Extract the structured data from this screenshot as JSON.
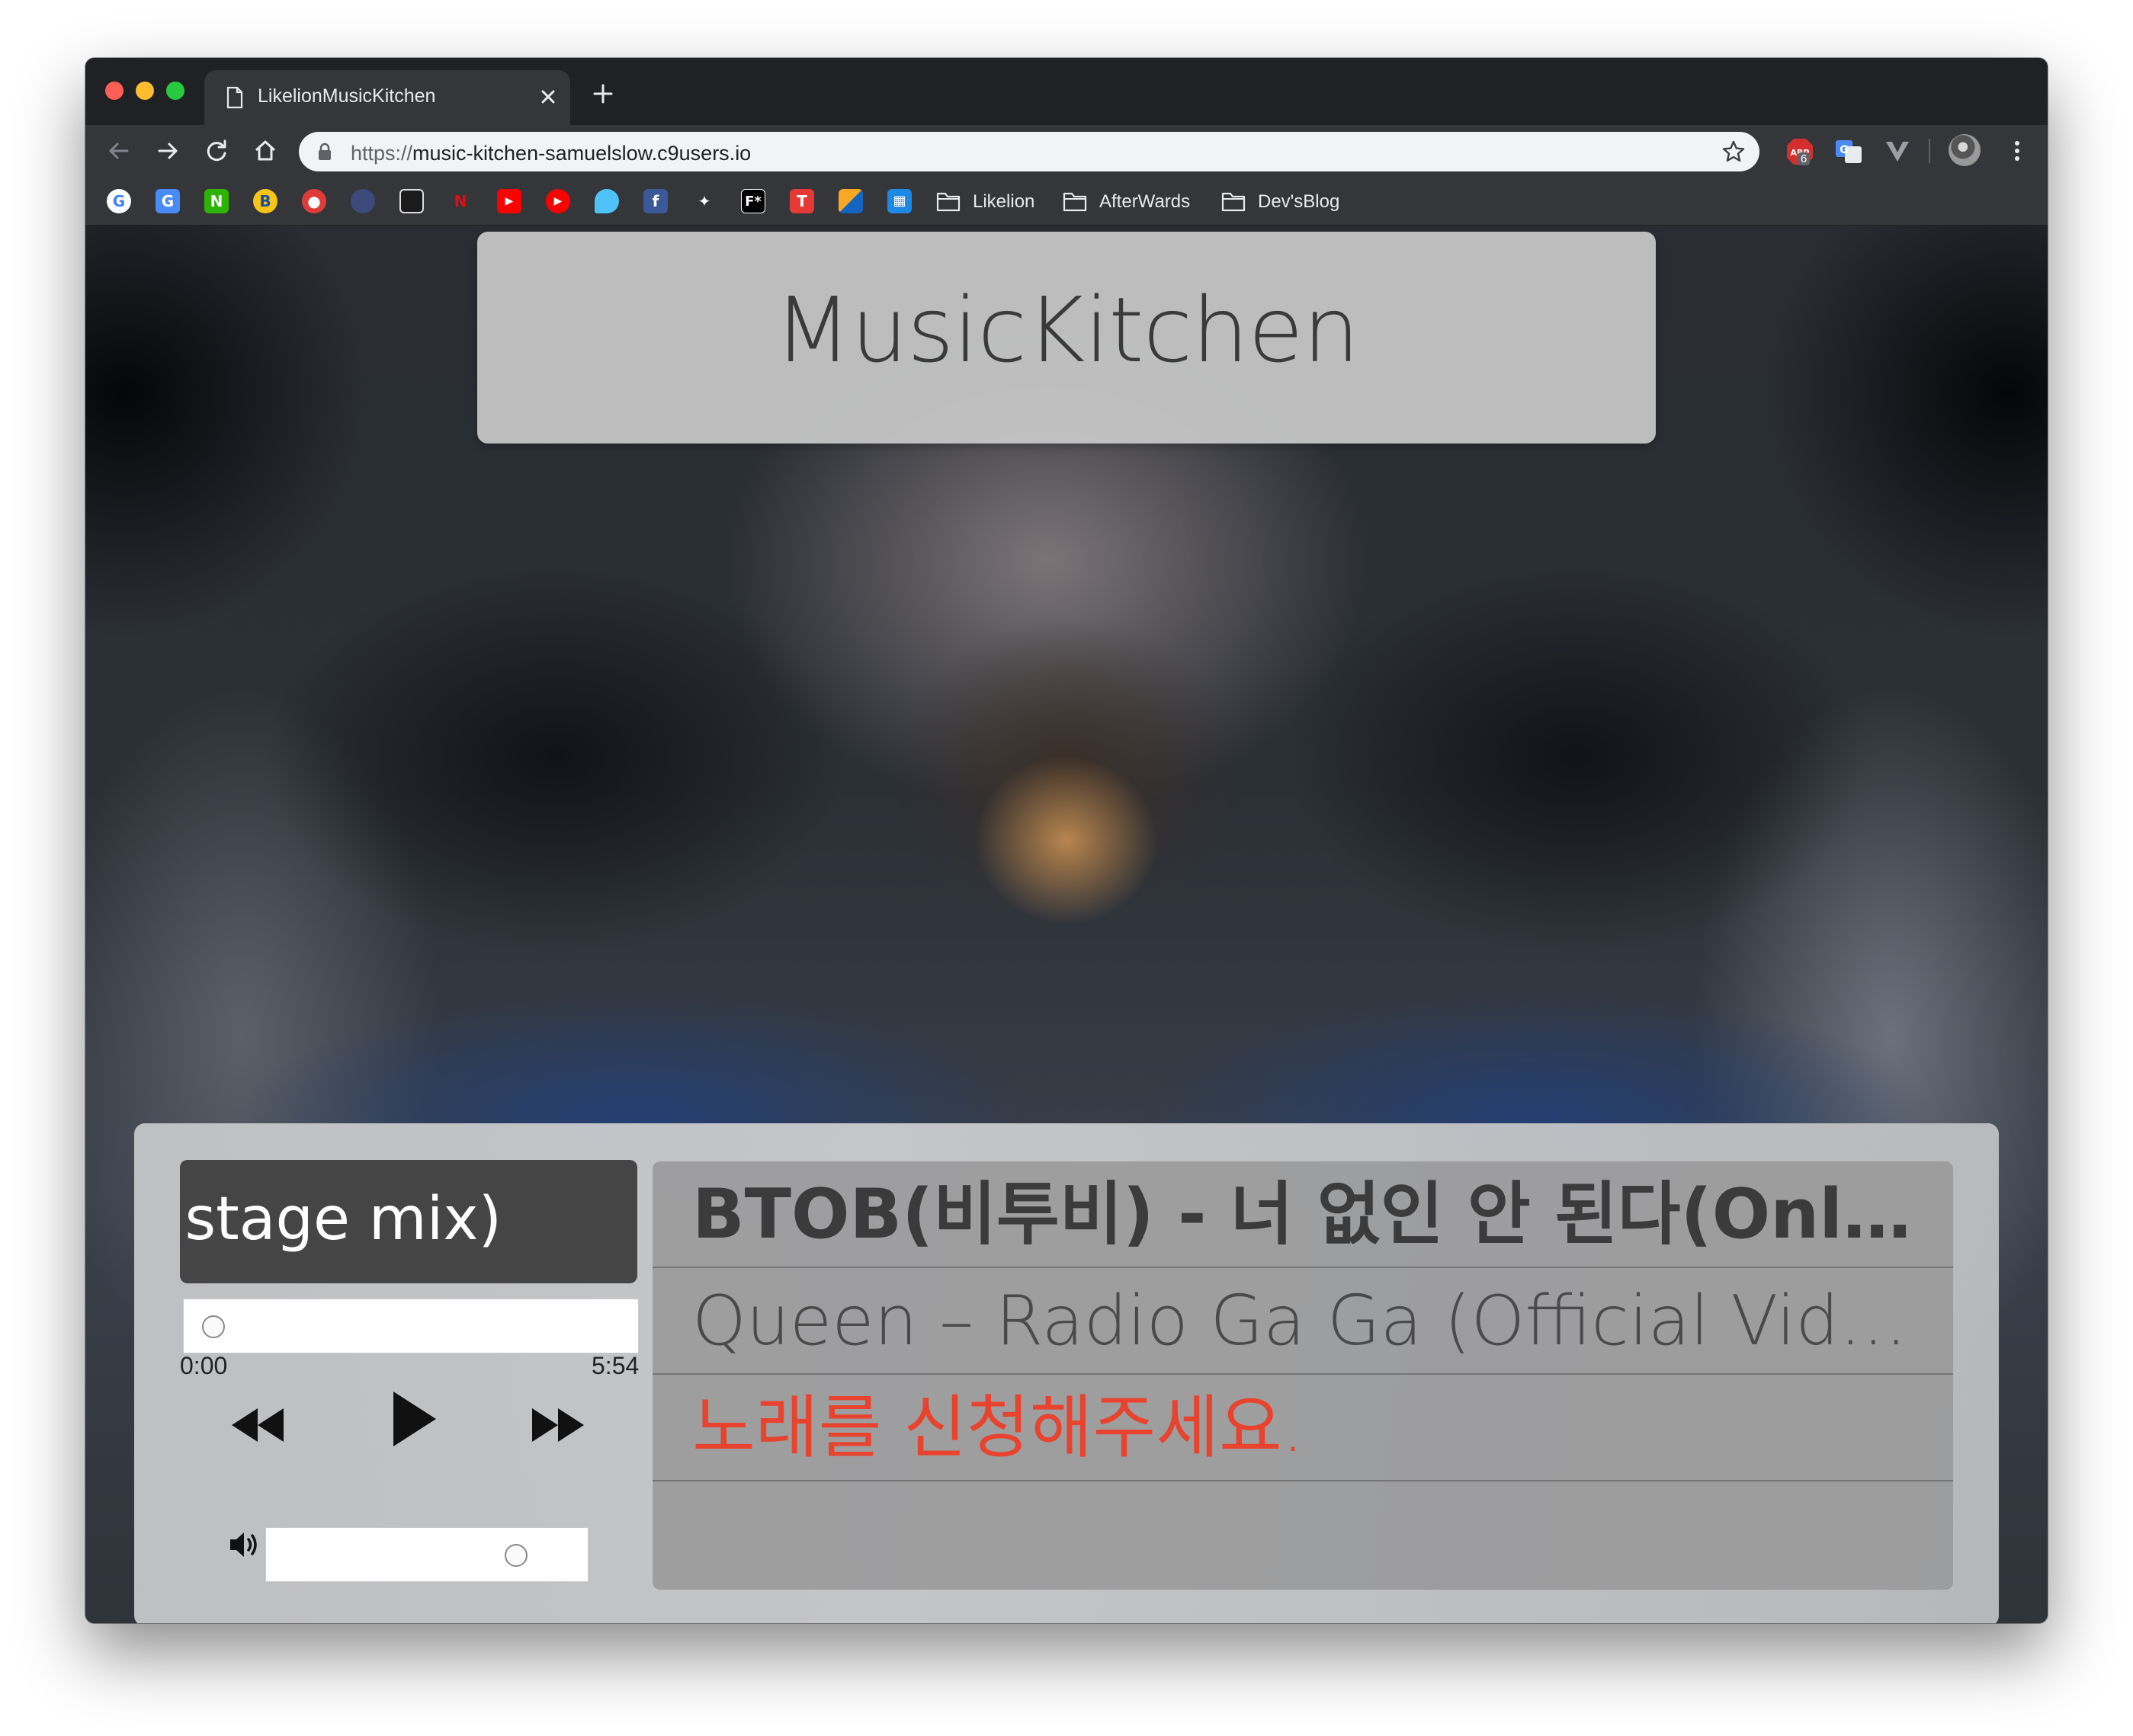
{
  "browser": {
    "tab": {
      "title": "LikelionMusicKitchen"
    },
    "address": {
      "scheme": "https://",
      "host": "music-kitchen-samuelslow.c9users.io"
    },
    "extensions": {
      "abp_count": "6"
    },
    "bookmarks": {
      "icons": [
        "google-icon",
        "translate-icon",
        "naver-icon",
        "tistory-icon",
        "daum-icon",
        "globe-icon",
        "windows-icon",
        "netflix-icon",
        "youtube-icon",
        "youtube-music-icon",
        "twitch-icon",
        "facebook-icon",
        "tidal-icon",
        "fstar-icon",
        "t-icon",
        "image-icon",
        "grid-icon"
      ],
      "folders": [
        "Likelion",
        "AfterWards",
        "Dev'sBlog"
      ]
    }
  },
  "page": {
    "title": "MusicKitchen",
    "player": {
      "now_playing": "집(stage mix)",
      "time_current": "0:00",
      "time_total": "5:54",
      "seek_progress": 0.0,
      "volume_level": 0.85
    },
    "playlist": [
      {
        "text": "BTOB(비투비) - 너 없인 안 된다(Only one for me)",
        "color": "#3b3b3b"
      },
      {
        "text": "Queen – Radio Ga Ga (Official Video)",
        "color": "#4a4a4a"
      },
      {
        "text": "노래를 신청해주세요.",
        "color": "#e8432e"
      }
    ]
  }
}
